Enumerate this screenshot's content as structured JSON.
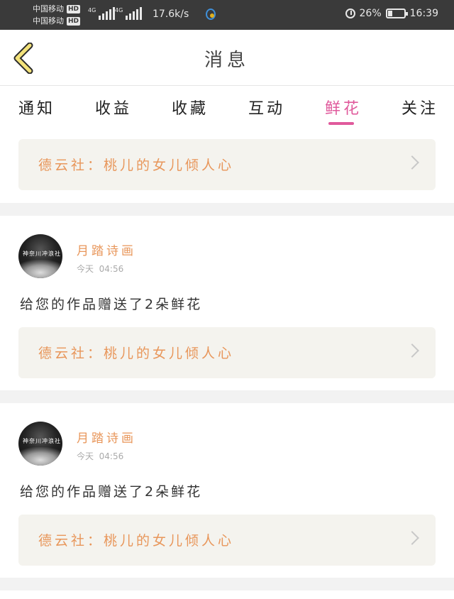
{
  "status_bar": {
    "carrier_1": "中国移动",
    "carrier_2": "中国移动",
    "hd_badge": "HD",
    "network_1": "4G",
    "network_2": "4G",
    "speed": "17.6k/s",
    "battery": "26%",
    "battery_level": 0.26,
    "time": "16:39"
  },
  "header": {
    "title": "消息"
  },
  "tabs": [
    {
      "label": "通知"
    },
    {
      "label": "收益"
    },
    {
      "label": "收藏"
    },
    {
      "label": "互动"
    },
    {
      "label": "鲜花",
      "active": true
    },
    {
      "label": "关注"
    }
  ],
  "top_work": "德云社：桃儿的女儿倾人心",
  "messages": [
    {
      "avatar_text": "神奈川冲浪社",
      "username": "月踏诗画",
      "day": "今天",
      "time": "04:56",
      "text": "给您的作品赠送了2朵鲜花",
      "work": "德云社：桃儿的女儿倾人心"
    },
    {
      "avatar_text": "神奈川冲浪社",
      "username": "月踏诗画",
      "day": "今天",
      "time": "04:56",
      "text": "给您的作品赠送了2朵鲜花",
      "work": "德云社：桃儿的女儿倾人心"
    }
  ],
  "colors": {
    "accent": "#e05a9c",
    "link_text": "#e8965a",
    "card_bg": "#f4f3ee",
    "back_arrow": "#f3e27a"
  }
}
